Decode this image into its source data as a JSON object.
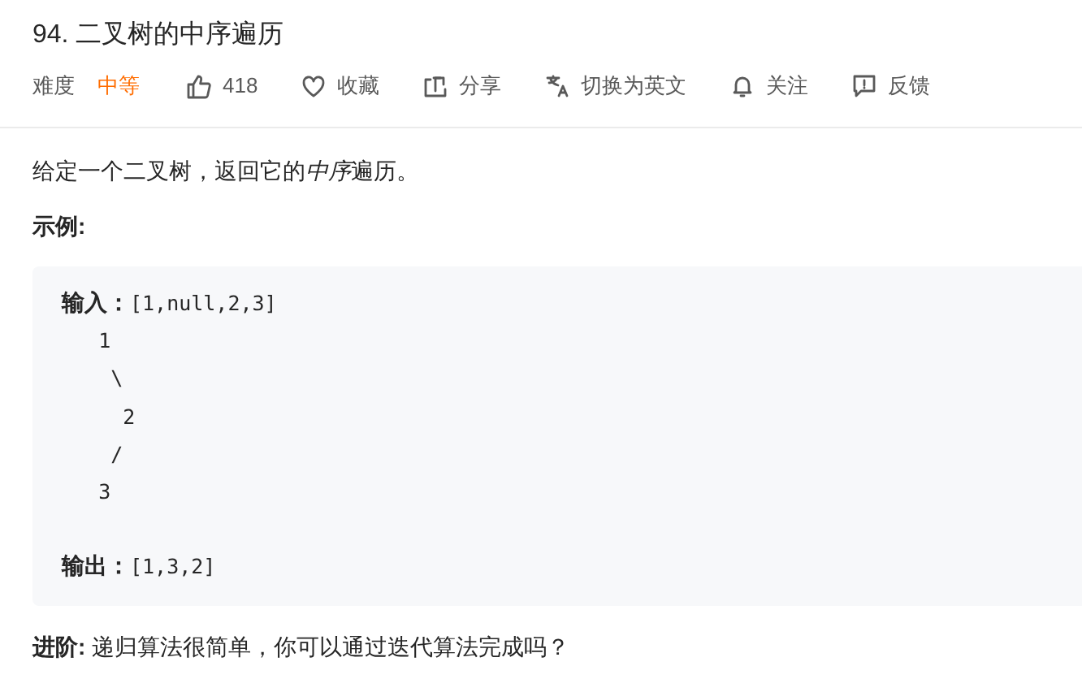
{
  "title": "94. 二叉树的中序遍历",
  "meta": {
    "difficulty_label": "难度",
    "difficulty": "中等",
    "actions": [
      {
        "kind": "like",
        "label": "418"
      },
      {
        "kind": "favorite",
        "label": "收藏"
      },
      {
        "kind": "share",
        "label": "分享"
      },
      {
        "kind": "translate",
        "label": "切换为英文"
      },
      {
        "kind": "follow",
        "label": "关注"
      },
      {
        "kind": "feedback",
        "label": "反馈"
      }
    ]
  },
  "description": [
    {
      "text": "给定一个二叉树，返回它的",
      "italic": false
    },
    {
      "text": "中序",
      "italic": true
    },
    {
      "text": "遍历。",
      "italic": false
    }
  ],
  "example_heading": "示例:",
  "code_input": "**输入：**[1,null,2,3]",
  "tree_lines": [
    "   1",
    "    \\",
    "     2",
    "    /",
    "   3"
  ],
  "code_output": "**输出：**[1,3,2]",
  "follow_up": "**进阶:** 递归算法很简单，你可以通过迭代算法完成吗？"
}
